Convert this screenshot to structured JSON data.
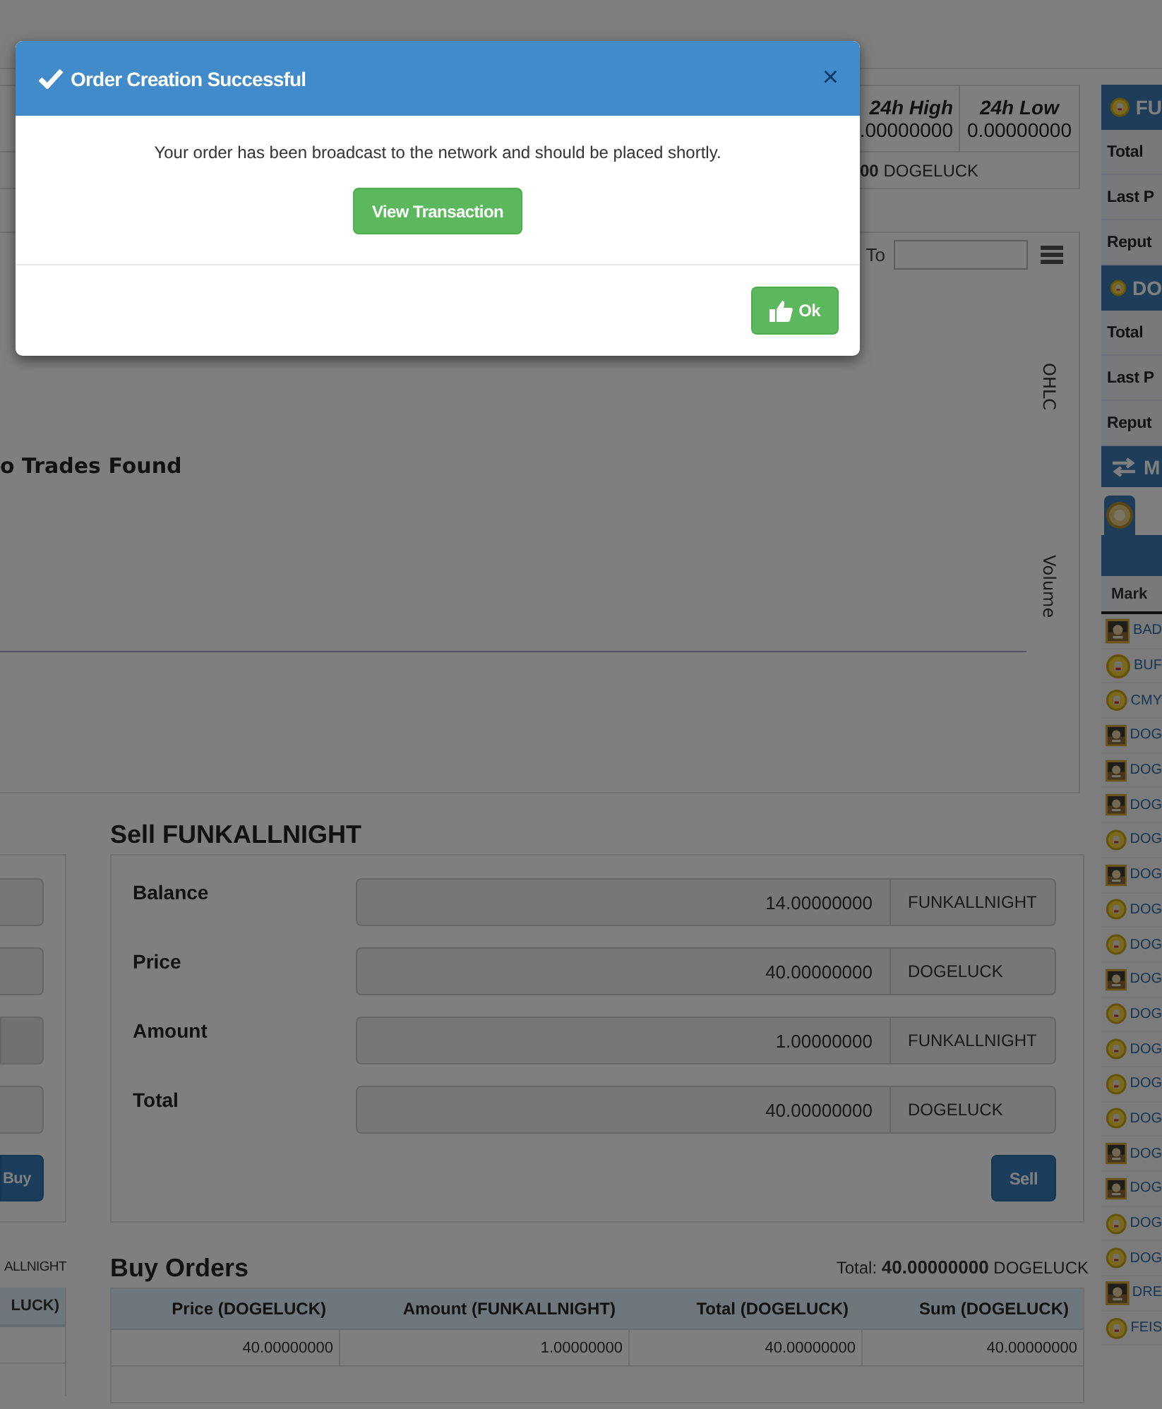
{
  "stats": {
    "columns": [
      {
        "label": "24h High",
        "value": ".00000000"
      },
      {
        "label": "24h Low",
        "value": "0.00000000"
      }
    ],
    "volume_amount": "00",
    "volume_unit": "DOGELUCK"
  },
  "chart": {
    "to_label": "To",
    "empty_message": "o Trades Found",
    "axis_labels": [
      "OHLC",
      "Volume"
    ]
  },
  "buy_form": {
    "fields": [
      {
        "kind": "input"
      },
      {
        "kind": "input"
      },
      {
        "kind": "addon"
      },
      {
        "kind": "input"
      }
    ],
    "button": "Buy",
    "summary_fragment": "ALLNIGHT",
    "table_header_fragment": "LUCK)"
  },
  "sell": {
    "title": "Sell FUNKALLNIGHT",
    "fields": [
      {
        "label": "Balance",
        "value": "14.00000000",
        "unit": "FUNKALLNIGHT"
      },
      {
        "label": "Price",
        "value": "40.00000000",
        "unit": "DOGELUCK"
      },
      {
        "label": "Amount",
        "value": "1.00000000",
        "unit": "FUNKALLNIGHT"
      },
      {
        "label": "Total",
        "value": "40.00000000",
        "unit": "DOGELUCK"
      }
    ],
    "button": "Sell"
  },
  "buy_orders": {
    "title": "Buy Orders",
    "total_label": "Total:",
    "total_value": "40.00000000",
    "total_unit": "DOGELUCK",
    "columns": [
      "Price (DOGELUCK)",
      "Amount (FUNKALLNIGHT)",
      "Total (DOGELUCK)",
      "Sum (DOGELUCK)"
    ],
    "rows": [
      [
        "40.00000000",
        "1.00000000",
        "40.00000000",
        "40.00000000"
      ]
    ]
  },
  "sidebar": {
    "panels": [
      {
        "title": "FU",
        "rows": [
          "Total",
          "Last P",
          "Reput"
        ]
      },
      {
        "title": "DO",
        "rows": [
          "Total",
          "Last P",
          "Reput"
        ]
      }
    ],
    "markets_title": "M",
    "markets_header": "Mark",
    "markets": [
      {
        "name": "BAD"
      },
      {
        "name": "BUF",
        "kind": "coin"
      },
      {
        "name": "CMY",
        "kind": "coin"
      },
      {
        "name": "DOG"
      },
      {
        "name": "DOG"
      },
      {
        "name": "DOG"
      },
      {
        "name": "DOG",
        "kind": "coin"
      },
      {
        "name": "DOG"
      },
      {
        "name": "DOG",
        "kind": "coin"
      },
      {
        "name": "DOG",
        "kind": "coin"
      },
      {
        "name": "DOG"
      },
      {
        "name": "DOG",
        "kind": "coin"
      },
      {
        "name": "DOG",
        "kind": "coin"
      },
      {
        "name": "DOG",
        "kind": "coin"
      },
      {
        "name": "DOG",
        "kind": "coin"
      },
      {
        "name": "DOG"
      },
      {
        "name": "DOG"
      },
      {
        "name": "DOG",
        "kind": "coin"
      },
      {
        "name": "DOG",
        "kind": "coin"
      },
      {
        "name": "DRE"
      },
      {
        "name": "FEIS",
        "kind": "coin"
      }
    ]
  },
  "modal": {
    "title": "Order Creation Successful",
    "close": "×",
    "message": "Your order has been broadcast to the network and should be placed shortly.",
    "action": "View Transaction",
    "ok": "Ok"
  }
}
